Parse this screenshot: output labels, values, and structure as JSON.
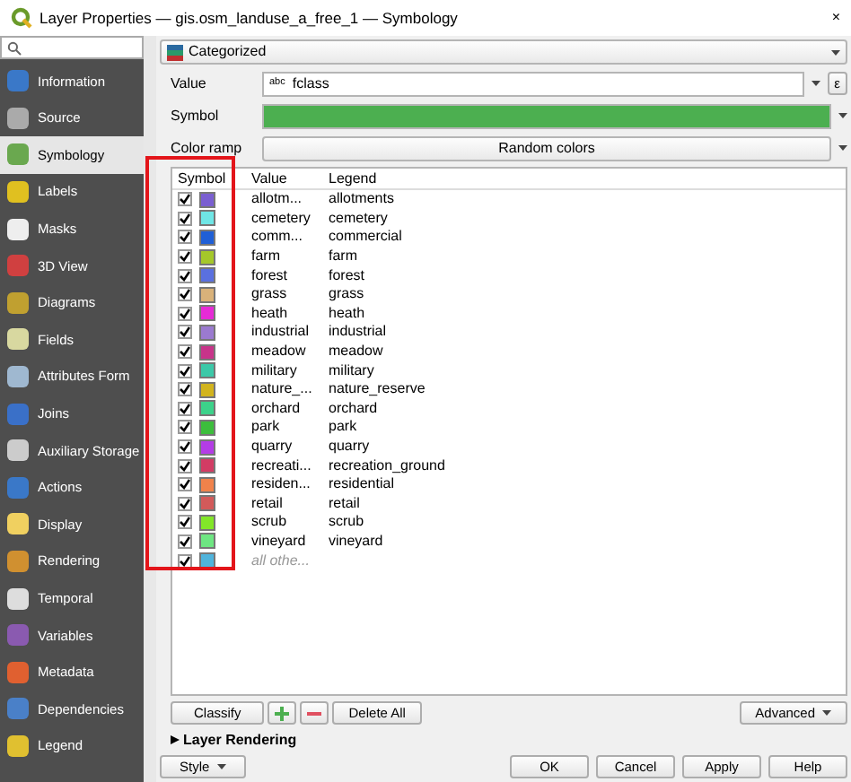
{
  "window": {
    "title": "Layer Properties — gis.osm_landuse_a_free_1 — Symbology",
    "close": "×"
  },
  "sidebar": {
    "items": [
      {
        "label": "Information",
        "selected": false
      },
      {
        "label": "Source",
        "selected": false
      },
      {
        "label": "Symbology",
        "selected": true
      },
      {
        "label": "Labels",
        "selected": false
      },
      {
        "label": "Masks",
        "selected": false
      },
      {
        "label": "3D View",
        "selected": false
      },
      {
        "label": "Diagrams",
        "selected": false
      },
      {
        "label": "Fields",
        "selected": false
      },
      {
        "label": "Attributes Form",
        "selected": false
      },
      {
        "label": "Joins",
        "selected": false
      },
      {
        "label": "Auxiliary Storage",
        "selected": false
      },
      {
        "label": "Actions",
        "selected": false
      },
      {
        "label": "Display",
        "selected": false
      },
      {
        "label": "Rendering",
        "selected": false
      },
      {
        "label": "Temporal",
        "selected": false
      },
      {
        "label": "Variables",
        "selected": false
      },
      {
        "label": "Metadata",
        "selected": false
      },
      {
        "label": "Dependencies",
        "selected": false
      },
      {
        "label": "Legend",
        "selected": false
      }
    ]
  },
  "renderer": "Categorized",
  "fields": [
    {
      "label": "Value",
      "kind": "field",
      "prefix": "abc",
      "value": "fclass",
      "button": "ε"
    },
    {
      "label": "Symbol",
      "kind": "symbol",
      "color": "#4caf50"
    },
    {
      "label": "Color ramp",
      "kind": "ramp",
      "value": "Random colors"
    }
  ],
  "table": {
    "columns": [
      "Symbol",
      "Value",
      "Legend"
    ],
    "rows": [
      {
        "checked": true,
        "color": "#7a5fd1",
        "value": "allotm...",
        "legend": "allotments"
      },
      {
        "checked": true,
        "color": "#6fe6e6",
        "value": "cemetery",
        "legend": "cemetery"
      },
      {
        "checked": true,
        "color": "#1f5fd6",
        "value": "comm...",
        "legend": "commercial"
      },
      {
        "checked": true,
        "color": "#a5c82a",
        "value": "farm",
        "legend": "farm"
      },
      {
        "checked": true,
        "color": "#5a70e0",
        "value": "forest",
        "legend": "forest"
      },
      {
        "checked": true,
        "color": "#d9b27a",
        "value": "grass",
        "legend": "grass"
      },
      {
        "checked": true,
        "color": "#e62ad6",
        "value": "heath",
        "legend": "heath"
      },
      {
        "checked": true,
        "color": "#9b7ad0",
        "value": "industrial",
        "legend": "industrial"
      },
      {
        "checked": true,
        "color": "#c8348a",
        "value": "meadow",
        "legend": "meadow"
      },
      {
        "checked": true,
        "color": "#3cc8a8",
        "value": "military",
        "legend": "military"
      },
      {
        "checked": true,
        "color": "#d2b41e",
        "value": "nature_...",
        "legend": "nature_reserve"
      },
      {
        "checked": true,
        "color": "#3cd28a",
        "value": "orchard",
        "legend": "orchard"
      },
      {
        "checked": true,
        "color": "#3cbe3c",
        "value": "park",
        "legend": "park"
      },
      {
        "checked": true,
        "color": "#b43ce6",
        "value": "quarry",
        "legend": "quarry"
      },
      {
        "checked": true,
        "color": "#d23c64",
        "value": "recreati...",
        "legend": "recreation_ground"
      },
      {
        "checked": true,
        "color": "#f0824b",
        "value": "residen...",
        "legend": "residential"
      },
      {
        "checked": true,
        "color": "#d25a5a",
        "value": "retail",
        "legend": "retail"
      },
      {
        "checked": true,
        "color": "#82e628",
        "value": "scrub",
        "legend": "scrub"
      },
      {
        "checked": true,
        "color": "#6ee682",
        "value": "vineyard",
        "legend": "vineyard"
      },
      {
        "checked": true,
        "color": "#50b4dc",
        "value": "all othe...",
        "kind": "other"
      }
    ]
  },
  "actions": [
    "Classify",
    "Delete All"
  ],
  "advanced": "Advanced",
  "section": {
    "label": "Layer Rendering",
    "expanded": false
  },
  "style_button": "Style",
  "dialog_buttons": [
    "OK",
    "Cancel",
    "Apply",
    "Help"
  ]
}
